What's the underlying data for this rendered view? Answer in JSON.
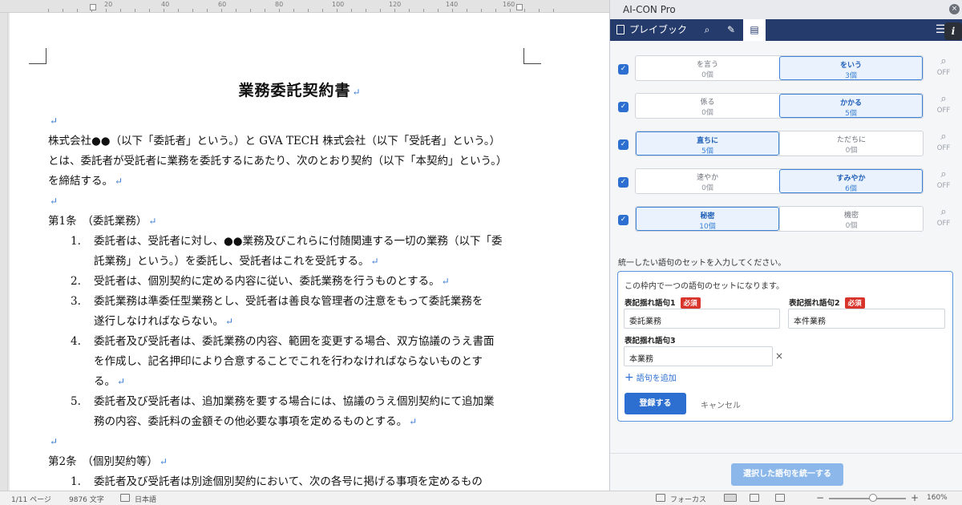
{
  "ruler": {
    "labels": [
      "20",
      "40",
      "60",
      "80",
      "100",
      "120",
      "140",
      "160"
    ]
  },
  "document": {
    "title": "業務委託契約書",
    "para_mark": "↵",
    "intro_lines": [
      "株式会社●●（以下「委託者」という。）と GVA TECH 株式会社（以下「受託者」という。）",
      "とは、委託者が受託者に業務を委託するにあたり、次のとおり契約（以下「本契約」という。）",
      "を締結する。"
    ],
    "article1_heading": "第1条　（委託業務）",
    "article1_items": [
      {
        "num": "1.",
        "lines": [
          "委託者は、受託者に対し、●●業務及びこれらに付随関連する一切の業務（以下「委",
          "託業務」という。）を委託し、受託者はこれを受託する。"
        ]
      },
      {
        "num": "2.",
        "lines": [
          "受託者は、個別契約に定める内容に従い、委託業務を行うものとする。"
        ]
      },
      {
        "num": "3.",
        "lines": [
          "委託業務は準委任型業務とし、受託者は善良な管理者の注意をもって委託業務を",
          "遂行しなければならない。"
        ]
      },
      {
        "num": "4.",
        "lines": [
          "委託者及び受託者は、委託業務の内容、範囲を変更する場合、双方協議のうえ書面",
          "を作成し、記名押印により合意することでこれを行わなければならないものとす",
          "る。"
        ]
      },
      {
        "num": "5.",
        "lines": [
          "委託者及び受託者は、追加業務を要する場合には、協議のうえ個別契約にて追加業",
          "務の内容、委託料の金額その他必要な事項を定めるものとする。"
        ]
      }
    ],
    "article2_heading": "第2条　（個別契約等）",
    "article2_items": [
      {
        "num": "1.",
        "lines": [
          "委託者及び受託者は別途個別契約において、次の各号に掲げる事項を定めるもの"
        ]
      }
    ]
  },
  "status": {
    "page": "1/11 ページ",
    "words": "9876 文字",
    "language": "日本語",
    "focus": "フォーカス",
    "zoom": "160%",
    "zoom_minus": "−",
    "zoom_plus": "+"
  },
  "panel": {
    "title": "AI-CON Pro",
    "close_glyph": "×",
    "nav": {
      "playbook": "プレイブック",
      "search_glyph": "⌕",
      "pen_glyph": "✎",
      "doc_glyph": "▤",
      "menu_glyph": "☰",
      "info": "i"
    },
    "check_glyph": "✓",
    "search_glyph": "⌕",
    "terms": [
      {
        "left": {
          "word": "を言う",
          "count": "0個"
        },
        "right": {
          "word": "をいう",
          "count": "3個"
        },
        "selected": "right",
        "toggle": "OFF"
      },
      {
        "left": {
          "word": "係る",
          "count": "0個"
        },
        "right": {
          "word": "かかる",
          "count": "5個"
        },
        "selected": "right",
        "toggle": "OFF"
      },
      {
        "left": {
          "word": "直ちに",
          "count": "5個"
        },
        "right": {
          "word": "ただちに",
          "count": "0個"
        },
        "selected": "left",
        "toggle": "OFF"
      },
      {
        "left": {
          "word": "速やか",
          "count": "0個"
        },
        "right": {
          "word": "すみやか",
          "count": "6個"
        },
        "selected": "right",
        "toggle": "OFF"
      },
      {
        "left": {
          "word": "秘密",
          "count": "10個"
        },
        "right": {
          "word": "機密",
          "count": "0個"
        },
        "selected": "left",
        "toggle": "OFF"
      }
    ],
    "prompt": "統一したい語句のセットを入力してください。",
    "set": {
      "hint": "この枠内で一つの語句のセットになります。",
      "required_badge": "必須",
      "field1_label": "表記揺れ語句1",
      "field1_value": "委託業務",
      "field2_label": "表記揺れ語句2",
      "field2_value": "本件業務",
      "field3_label": "表記揺れ語句3",
      "field3_value": "本業務",
      "remove_glyph": "×",
      "add_plus": "+",
      "add_label": "語句を追加",
      "register_label": "登録する",
      "cancel_label": "キャンセル"
    },
    "unify_label": "選択した語句を統一する"
  },
  "colors": {
    "navbar": "#243b6b",
    "accent": "#2c6fd1",
    "required": "#d9342b",
    "unify_button": "#8bb7ea"
  }
}
